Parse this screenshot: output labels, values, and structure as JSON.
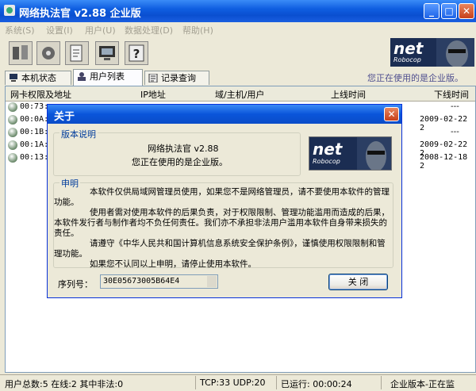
{
  "window": {
    "title": "网络执法官  v2.88  企业版"
  },
  "menu": [
    "系统(S)",
    "设置(I)",
    "用户(U)",
    "数据处理(D)",
    "帮助(H)"
  ],
  "logo": {
    "net": "net",
    "robo": "Robocop"
  },
  "tabs": [
    "本机状态",
    "用户列表",
    "记录查询"
  ],
  "status_note": "您正在使用的是企业版。",
  "list": {
    "columns": [
      "网卡权限及地址",
      "IP地址",
      "域/主机/用户",
      "上线时间",
      "下线时间"
    ],
    "rows": [
      {
        "mac": "00:73:",
        "offline": "---"
      },
      {
        "mac": "00:0A:E",
        "offline": "2009-02-22 2"
      },
      {
        "mac": "00:1B:3",
        "offline": "---"
      },
      {
        "mac": "00:1A:4",
        "offline": "2009-02-22 2"
      },
      {
        "mac": "00:13:7",
        "offline": "2008-12-18 2"
      }
    ]
  },
  "statusbar": {
    "users": "用户总数:5 在线:2 其中非法:0",
    "ports": "TCP:33 UDP:20",
    "runtime": "已运行: 00:00:24",
    "mode": "企业版本-正在监"
  },
  "dialog": {
    "title": "关于",
    "version_group": "版本说明",
    "version_line1": "网络执法官 v2.88",
    "version_line2": "您正在使用的是企业版。",
    "statement_group": "申明",
    "statement": [
      "本软件仅供局域网管理员使用，如果您不是网络管理员，请不要使用本软件的管理功能。",
      "使用者需对使用本软件的后果负责，对于权限限制、管理功能滥用而造成的后果，本软件发行者与制作者均不负任何责任。我们亦不承担非法用户滥用本软件自身带来损失的责任。",
      "请遵守《中华人民共和国计算机信息系统安全保护条例》，谨慎使用权限限制和管理功能。",
      "如果您不认同以上申明，请停止使用本软件。"
    ],
    "serial_label": "序列号：",
    "serial_value": "30E05673005B64E4",
    "ok_label": "关  闭"
  }
}
